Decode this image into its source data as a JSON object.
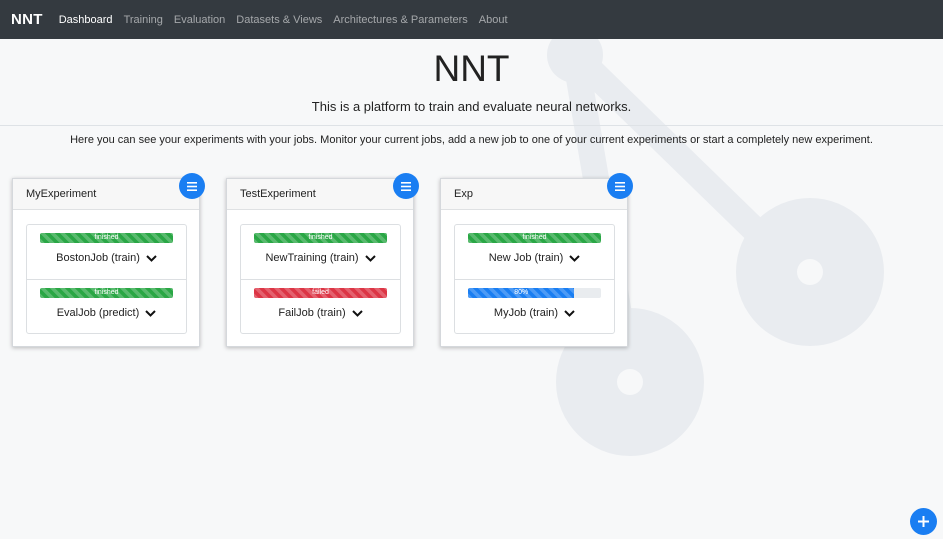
{
  "navbar": {
    "brand": "NNT",
    "links": [
      {
        "label": "Dashboard",
        "active": true
      },
      {
        "label": "Training",
        "active": false
      },
      {
        "label": "Evaluation",
        "active": false
      },
      {
        "label": "Datasets & Views",
        "active": false
      },
      {
        "label": "Architectures & Parameters",
        "active": false
      },
      {
        "label": "About",
        "active": false
      }
    ]
  },
  "hero": {
    "title": "NNT",
    "subtitle": "This is a platform to train and evaluate neural networks."
  },
  "intro": "Here you can see your experiments with your jobs. Monitor your current jobs, add a new job to one of your current experiments or start a completely new experiment.",
  "experiments": [
    {
      "name": "MyExperiment",
      "jobs": [
        {
          "status_label": "finished",
          "status": "finished",
          "progress": 1.0,
          "name": "BostonJob (train)"
        },
        {
          "status_label": "finished",
          "status": "finished",
          "progress": 1.0,
          "name": "EvalJob (predict)"
        }
      ]
    },
    {
      "name": "TestExperiment",
      "jobs": [
        {
          "status_label": "finished",
          "status": "finished",
          "progress": 1.0,
          "name": "NewTraining (train)"
        },
        {
          "status_label": "failed",
          "status": "failed",
          "progress": 1.0,
          "name": "FailJob (train)"
        }
      ]
    },
    {
      "name": "Exp",
      "jobs": [
        {
          "status_label": "finished",
          "status": "finished",
          "progress": 1.0,
          "name": "New Job (train)"
        },
        {
          "status_label": "80%",
          "status": "running",
          "progress": 0.8,
          "name": "MyJob (train)"
        }
      ]
    }
  ],
  "icons": {
    "card_menu": "menu-icon",
    "job_toggle": "chevron-down-icon",
    "add": "plus-icon"
  },
  "colors": {
    "navbar": "#343a40",
    "primary": "#1a7ef2",
    "success": "#2aa745",
    "danger": "#dc3545"
  }
}
